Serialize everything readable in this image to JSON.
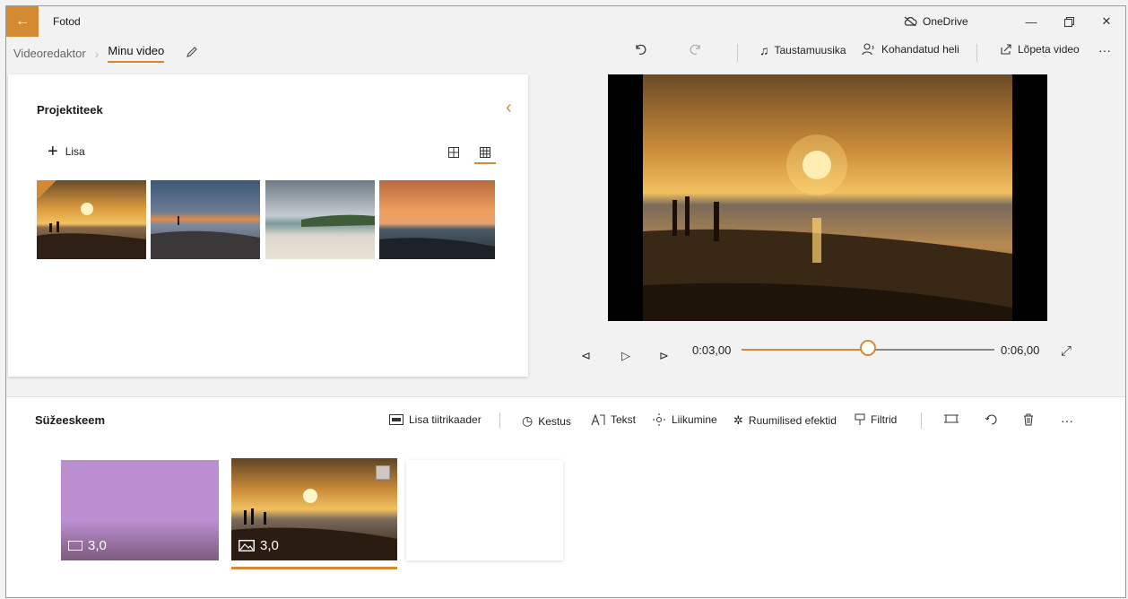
{
  "window": {
    "app_name": "Fotod",
    "onedrive_label": "OneDrive",
    "accent_color": "#d48a33"
  },
  "breadcrumb": {
    "parent": "Videoredaktor",
    "current": "Minu video"
  },
  "toolbar": {
    "background_music": "Taustamuusika",
    "custom_audio": "Kohandatud heli",
    "finish_video": "Lõpeta video",
    "more": "···"
  },
  "library": {
    "title": "Projektiteek",
    "add_label": "Lisa",
    "thumbnails": [
      "sunset-beach-1",
      "sunset-beach-2",
      "cloudy-beach",
      "sunset-sea"
    ]
  },
  "player": {
    "current_time": "0:03,00",
    "total_time": "0:06,00",
    "progress": 0.5
  },
  "storyboard": {
    "title": "Süžeeskeem",
    "tools": {
      "add_title_card": "Lisa tiitrikaader",
      "duration": "Kestus",
      "text": "Tekst",
      "motion": "Liikumine",
      "3d_effects": "Ruumilised efektid",
      "filters": "Filtrid",
      "more": "···"
    },
    "cards": [
      {
        "type": "title-card",
        "duration": "3,0",
        "color": "#bb8fcf"
      },
      {
        "type": "photo",
        "duration": "3,0",
        "selected": true
      }
    ]
  }
}
